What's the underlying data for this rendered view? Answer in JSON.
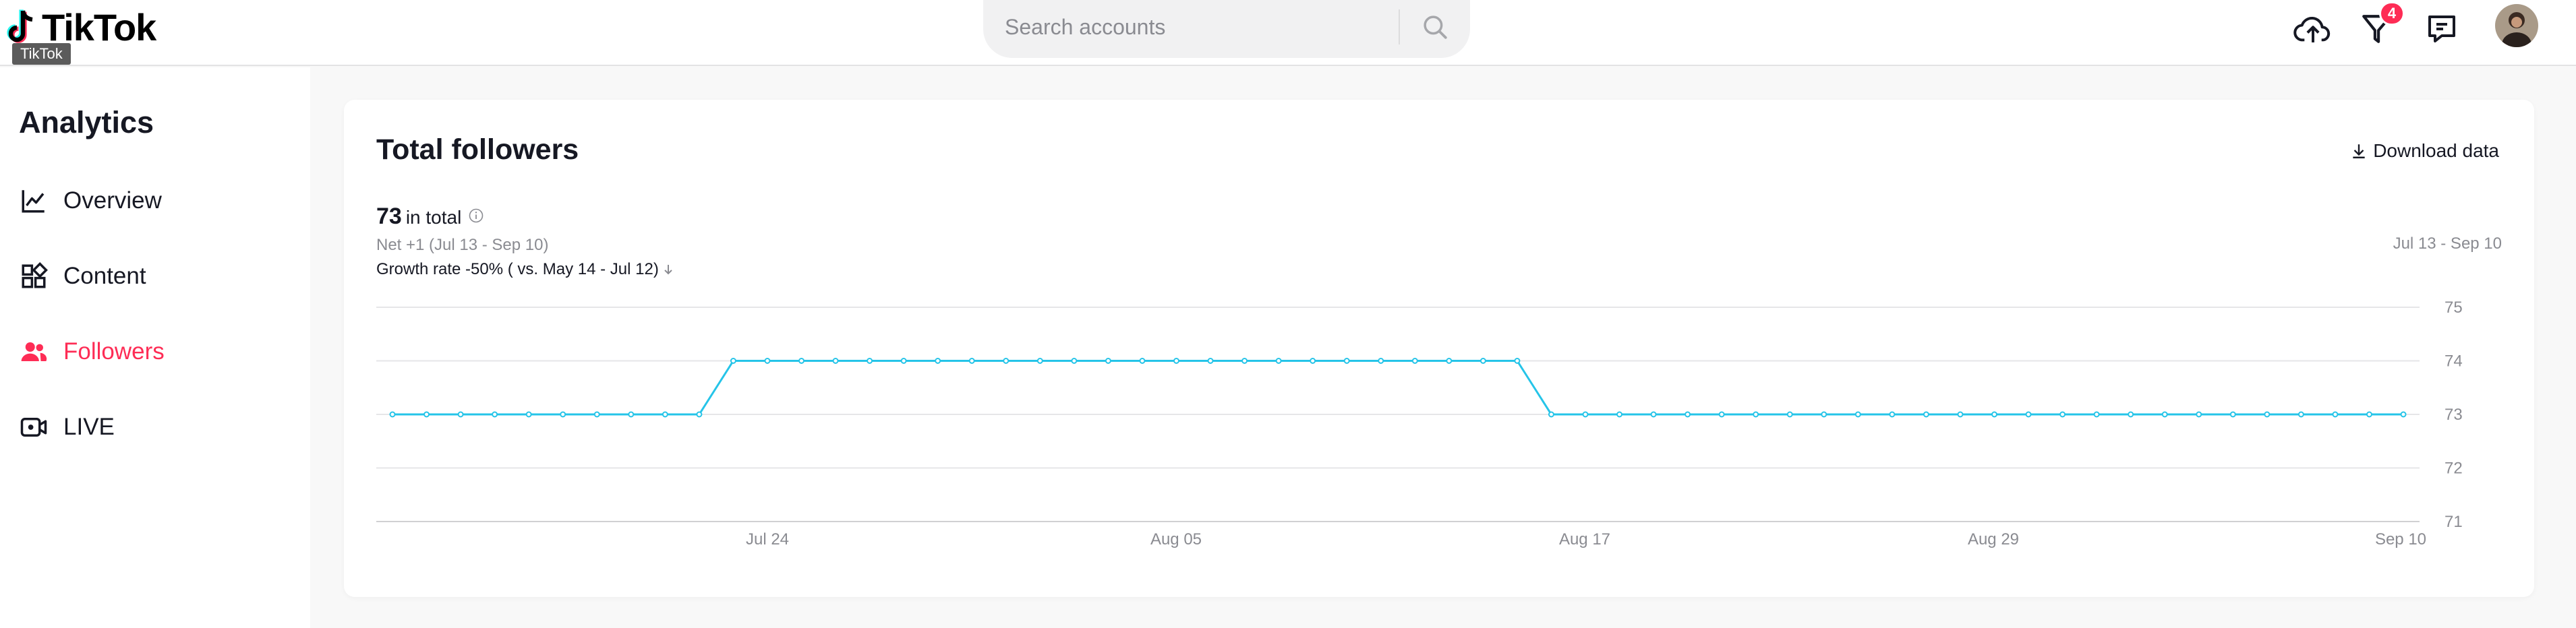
{
  "header": {
    "logo_text": "TikTok",
    "logo_tooltip": "TikTok",
    "search_placeholder": "Search accounts",
    "inbox_badge": "4",
    "icons": [
      "upload-icon",
      "inbox-icon",
      "messages-icon",
      "search-icon"
    ],
    "colors": {
      "accent": "#fe2c55",
      "logo_cyan": "#25f4ee"
    }
  },
  "sidebar": {
    "title": "Analytics",
    "items": [
      {
        "label": "Overview",
        "icon": "line-chart-icon",
        "active": false
      },
      {
        "label": "Content",
        "icon": "grid-icon",
        "active": false
      },
      {
        "label": "Followers",
        "icon": "people-icon",
        "active": true
      },
      {
        "label": "LIVE",
        "icon": "live-camera-icon",
        "active": false
      }
    ]
  },
  "card": {
    "title": "Total followers",
    "download_label": "Download data",
    "total_number": "73",
    "total_label": "in total",
    "net_text": "Net +1 (Jul 13 - Sep 10)",
    "growth_text": "Growth rate -50% ( vs. May 14 - Jul 12)",
    "date_range": "Jul 13 - Sep 10"
  },
  "chart_data": {
    "type": "line",
    "title": "",
    "xlabel": "",
    "ylabel": "",
    "x_ticks": [
      "Jul 24",
      "Aug 05",
      "Aug 17",
      "Aug 29",
      "Sep 10"
    ],
    "y_ticks": [
      75,
      74,
      73,
      72,
      71
    ],
    "ylim": [
      71,
      75
    ],
    "x_start": "Jul 13",
    "x_end": "Sep 10",
    "grid": true,
    "line_color": "#25c4e8",
    "series": [
      {
        "values": [
          73,
          73,
          73,
          73,
          73,
          73,
          73,
          73,
          73,
          73,
          74,
          74,
          74,
          74,
          74,
          74,
          74,
          74,
          74,
          74,
          74,
          74,
          74,
          74,
          74,
          74,
          74,
          74,
          74,
          74,
          74,
          74,
          74,
          74,
          73,
          73,
          73,
          73,
          73,
          73,
          73,
          73,
          73,
          73,
          73,
          73,
          73,
          73,
          73,
          73,
          73,
          73,
          73,
          73,
          73,
          73,
          73,
          73,
          73,
          73
        ]
      }
    ]
  }
}
